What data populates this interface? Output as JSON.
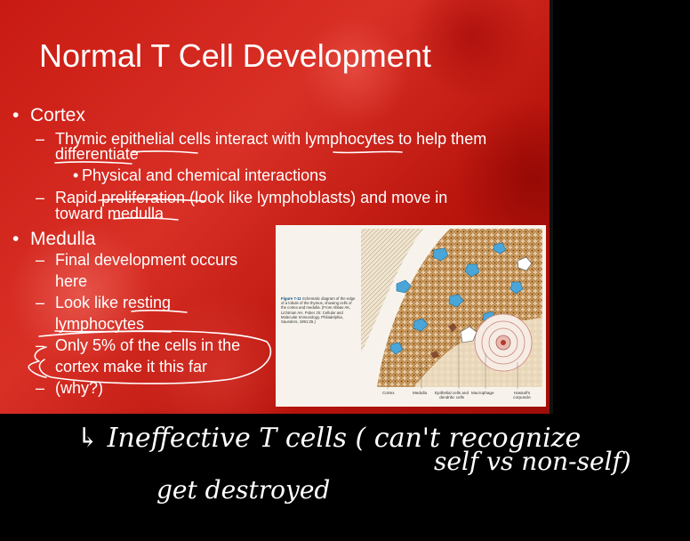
{
  "slide": {
    "title": "Normal T Cell Development",
    "bullets": {
      "cortex": {
        "label": "Cortex",
        "sub1_line1": "Thymic epithelial cells interact with lymphocytes to help them",
        "sub1_line2": "differentiate",
        "sub1_child": "Physical and chemical interactions",
        "sub2_line1": "Rapid proliferation (look like lymphoblasts) and move in",
        "sub2_line2": "toward medulla"
      },
      "medulla": {
        "label": "Medulla",
        "sub1_line1": "Final development occurs",
        "sub1_line2": "here",
        "sub2_line1": "Look like resting",
        "sub2_line2": "lymphocytes",
        "sub3_line1": "Only 5% of the cells in the",
        "sub3_line2": "cortex make it this far",
        "sub4": "(why?)"
      }
    },
    "glyphs": {
      "bullet": "•",
      "dash": "–"
    }
  },
  "figure": {
    "caption_label": "Figure 7-11",
    "caption_text": "Schematic diagram of the edge of a lobule of the thymus, showing cells of the cortex and medulla. (From Abbas AK, Lichtman AH, Pober JS: Cellular and Molecular Immunology. Philadelphia, Saunders, 1991:25.)",
    "labels": {
      "cortex": "Cortex",
      "medulla": "Medulla",
      "epithelial": "Epithelial cells and dendritic cells",
      "macrophage": "Macrophage",
      "hassall": "Hassall's corpuscle"
    }
  },
  "annotations": {
    "line1": "↳ Ineffective   T   cells ( can't recognize",
    "line2": "self vs  non-self)",
    "line3": "get  destroyed"
  },
  "colors": {
    "slide_red": "#c81a12",
    "text": "#ffffff",
    "ink": "#ffffff",
    "canvas": "#000000"
  }
}
